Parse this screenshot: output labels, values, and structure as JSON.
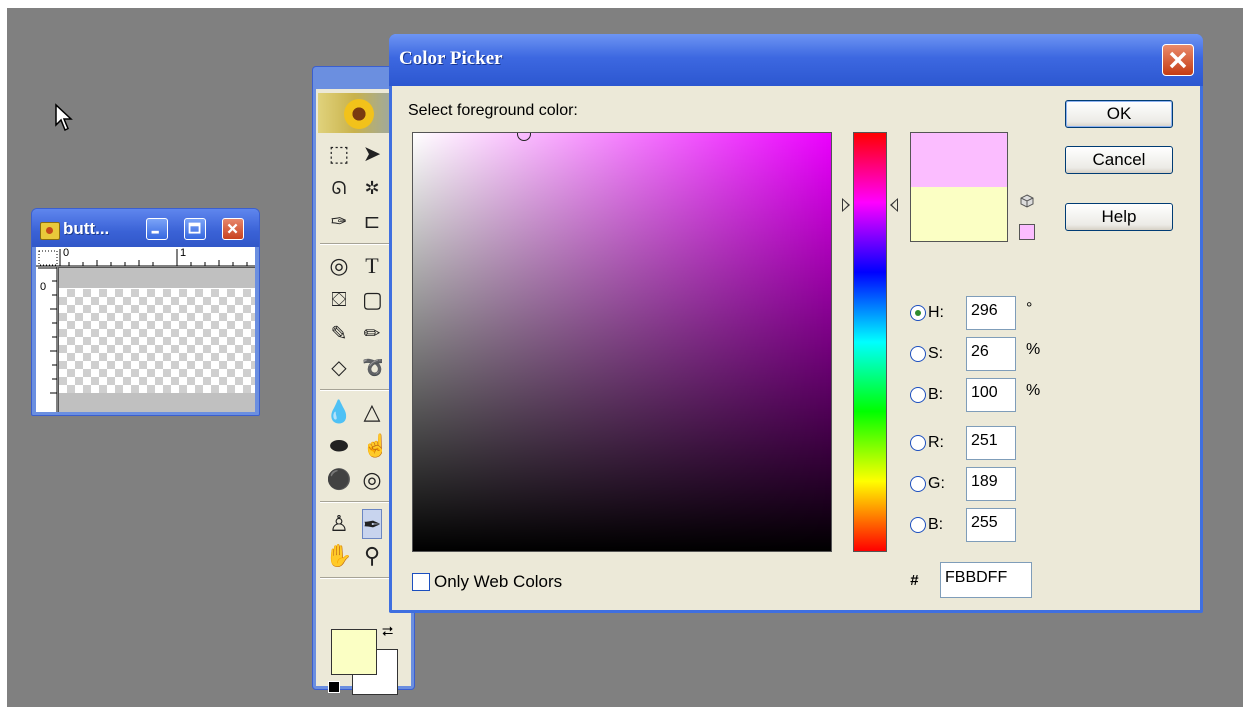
{
  "doc_window": {
    "title": "butt...",
    "ruler_top": [
      "0",
      "1"
    ],
    "ruler_left": [
      "0"
    ]
  },
  "picker": {
    "title": "Color Picker",
    "prompt": "Select foreground color:",
    "buttons": {
      "ok": "OK",
      "cancel": "Cancel",
      "help": "Help"
    },
    "hsb": {
      "h": {
        "label": "H:",
        "value": "296",
        "unit": "°"
      },
      "s": {
        "label": "S:",
        "value": "26",
        "unit": "%"
      },
      "b": {
        "label": "B:",
        "value": "100",
        "unit": "%"
      }
    },
    "rgb": {
      "r": {
        "label": "R:",
        "value": "251"
      },
      "g": {
        "label": "G:",
        "value": "189"
      },
      "b": {
        "label": "B:",
        "value": "255"
      }
    },
    "hex": {
      "label": "#",
      "value": "FBBDFF"
    },
    "only_web_colors": "Only Web Colors",
    "selected_radio": "H",
    "new_color": "#fbbdff",
    "current_color": "#fbffc4",
    "hue_field_color": "#ec00ff"
  },
  "toolbox": {
    "foreground_color": "#fbffc4",
    "background_color": "#ffffff"
  }
}
